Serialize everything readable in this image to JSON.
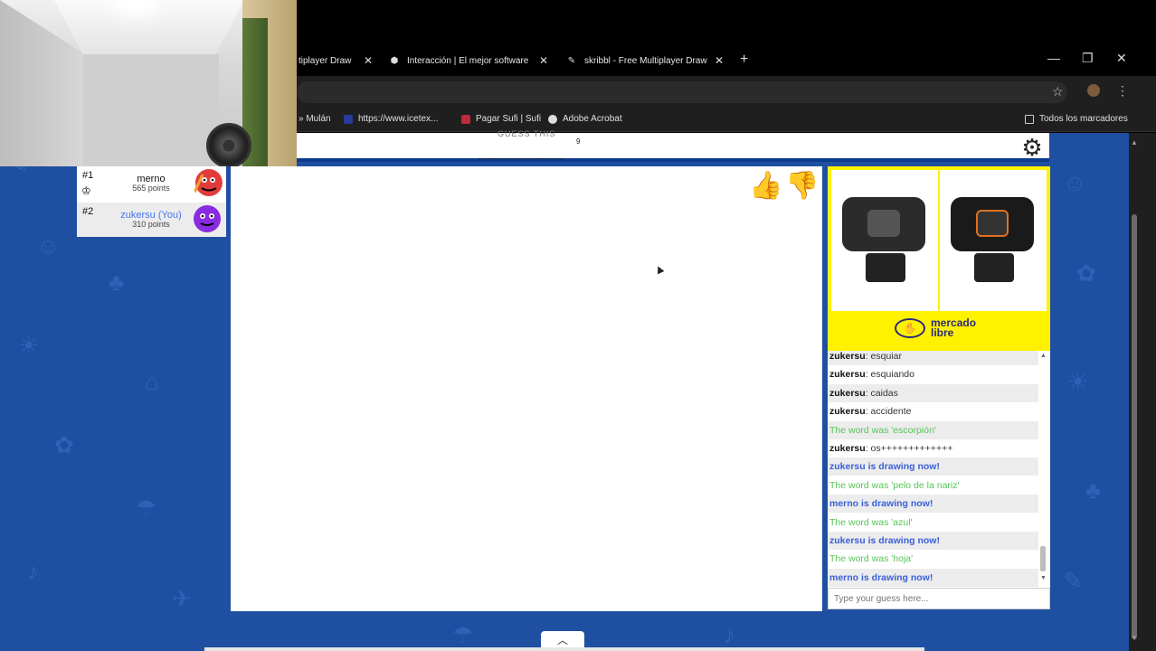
{
  "browser": {
    "tabs": [
      {
        "label": "tiplayer Draw",
        "icon": "skribbl-icon"
      },
      {
        "label": "Interacción | El mejor software",
        "icon": "shield-icon"
      },
      {
        "label": "skribbl - Free Multiplayer Draw",
        "icon": "skribbl-icon"
      }
    ],
    "new_tab_label": "+",
    "bookmarks": [
      {
        "label": "» Mulán",
        "icon": "folder-icon"
      },
      {
        "label": "https://www.icetex...",
        "icon": "icetex-icon"
      },
      {
        "label": "Pagar Sufi | Sufi",
        "icon": "bank-icon"
      },
      {
        "label": "Adobe Acrobat",
        "icon": "globe-icon"
      }
    ],
    "all_bookmarks_label": "Todos los marcadores"
  },
  "game": {
    "guess_hint": "GUESS THIS",
    "word_blanks": "_________",
    "word_length": "9",
    "players": [
      {
        "rank": "#1",
        "name": "merno",
        "points": "565 points",
        "crown": true,
        "avatar_color": "#e23b3b"
      },
      {
        "rank": "#2",
        "name": "zukersu (You)",
        "points": "310 points",
        "crown": false,
        "avatar_color": "#8a2be2"
      }
    ],
    "chat": [
      {
        "who": "zukersu",
        "text": "esquiar",
        "kind": "guess"
      },
      {
        "who": "zukersu",
        "text": "esquiando",
        "kind": "guess"
      },
      {
        "who": "zukersu",
        "text": "caidas",
        "kind": "guess"
      },
      {
        "who": "zukersu",
        "text": "accidente",
        "kind": "guess"
      },
      {
        "who": "",
        "text": "The word was 'escorpión'",
        "kind": "green"
      },
      {
        "who": "zukersu",
        "text": "os+++++++++++++",
        "kind": "guess"
      },
      {
        "who": "",
        "text": "zukersu is drawing now!",
        "kind": "blue"
      },
      {
        "who": "",
        "text": "The word was 'pelo de la nariz'",
        "kind": "green"
      },
      {
        "who": "",
        "text": "merno is drawing now!",
        "kind": "blue"
      },
      {
        "who": "",
        "text": "The word was 'azul'",
        "kind": "green"
      },
      {
        "who": "",
        "text": "zukersu is drawing now!",
        "kind": "blue"
      },
      {
        "who": "",
        "text": "The word was 'hoja'",
        "kind": "green"
      },
      {
        "who": "",
        "text": "merno is drawing now!",
        "kind": "blue"
      }
    ],
    "chat_placeholder": "Type your guess here...",
    "ad_brand_line1": "mercado",
    "ad_brand_line2": "libre"
  },
  "colors": {
    "page_bg": "#1f4fa0",
    "ad_bg": "#fff200",
    "chat_green": "#57c457",
    "chat_blue": "#3a5fd8"
  }
}
